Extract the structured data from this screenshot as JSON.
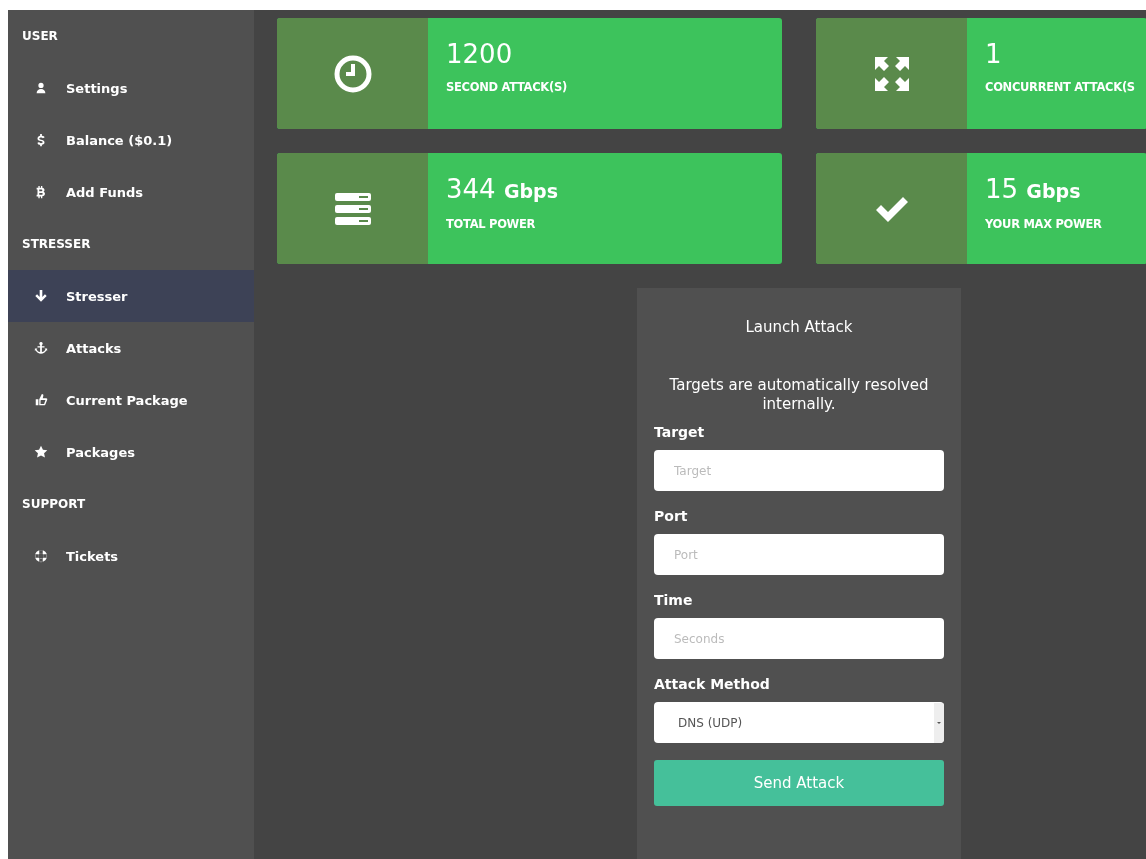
{
  "sidebar": {
    "sections": [
      {
        "title": "USER",
        "items": [
          {
            "label": "Settings",
            "selected": false
          },
          {
            "label": "Balance ($0.1)",
            "selected": false
          },
          {
            "label": "Add Funds",
            "selected": false
          }
        ]
      },
      {
        "title": "STRESSER",
        "items": [
          {
            "label": "Stresser",
            "selected": true
          },
          {
            "label": "Attacks",
            "selected": false
          },
          {
            "label": "Current Package",
            "selected": false
          },
          {
            "label": "Packages",
            "selected": false
          }
        ]
      },
      {
        "title": "SUPPORT",
        "items": [
          {
            "label": "Tickets",
            "selected": false
          }
        ]
      }
    ]
  },
  "stats": [
    {
      "value": "1200",
      "label": "SECOND ATTACK(S)"
    },
    {
      "value": "1",
      "label": "CONCURRENT ATTACK(S"
    },
    {
      "value": "344",
      "unit": "Gbps",
      "label": "TOTAL POWER"
    },
    {
      "value": "15",
      "unit": "Gbps",
      "label": "YOUR MAX POWER"
    }
  ],
  "form": {
    "title": "Launch Attack",
    "note": "Targets are automatically resolved internally.",
    "fields": [
      {
        "kind": "input",
        "label": "Target",
        "placeholder": "Target"
      },
      {
        "kind": "input",
        "label": "Port",
        "placeholder": "Port"
      },
      {
        "kind": "input",
        "label": "Time",
        "placeholder": "Seconds"
      },
      {
        "kind": "select",
        "label": "Attack Method",
        "value": "DNS (UDP)"
      }
    ],
    "button": "Send Attack"
  }
}
